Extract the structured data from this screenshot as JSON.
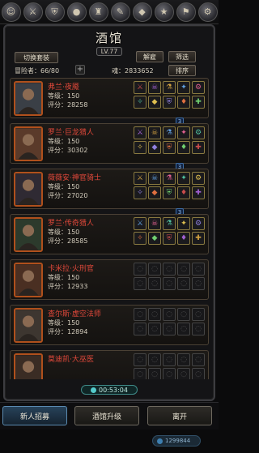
{
  "top_icons": [
    "person-icon",
    "sword-icon",
    "shield-icon",
    "orb-icon",
    "helmet-icon",
    "scroll-icon",
    "gem-icon",
    "star-icon",
    "flag-icon",
    "settings-icon"
  ],
  "header": {
    "title": "酒馆",
    "level": "LV.77"
  },
  "toolbar": {
    "switch_outfit": "切换套装",
    "dismiss": "解雇",
    "filter": "筛选",
    "sort": "排序"
  },
  "stats": {
    "adventurers_label": "冒险者：",
    "adventurers_value": "66/80",
    "soul_label": "魂：",
    "soul_value": "2833652"
  },
  "heroes": [
    {
      "name": "弗兰·夜魇",
      "level_label": "等级：",
      "level": "150",
      "score_label": "评分：",
      "score": "28258",
      "gear_filled": true,
      "linked": true
    },
    {
      "name": "罗兰·巨龙猎人",
      "level_label": "等级：",
      "level": "150",
      "score_label": "评分：",
      "score": "30302",
      "gear_filled": true,
      "linked": true
    },
    {
      "name": "薇薇安·神官骑士",
      "level_label": "等级：",
      "level": "150",
      "score_label": "评分：",
      "score": "27020",
      "gear_filled": true,
      "linked": true
    },
    {
      "name": "罗兰·传奇猎人",
      "level_label": "等级：",
      "level": "150",
      "score_label": "评分：",
      "score": "28585",
      "gear_filled": true,
      "linked": false
    },
    {
      "name": "卡米拉·火刑官",
      "level_label": "等级：",
      "level": "150",
      "score_label": "评分：",
      "score": "12933",
      "gear_filled": false,
      "linked": false
    },
    {
      "name": "查尔斯·虚空法师",
      "level_label": "等级：",
      "level": "150",
      "score_label": "评分：",
      "score": "12894",
      "gear_filled": false,
      "linked": false
    },
    {
      "name": "莫迪凯·大巫医",
      "level_label": "",
      "level": "",
      "score_label": "",
      "score": "",
      "gear_filled": false,
      "linked": false
    }
  ],
  "timer": "00:53:04",
  "bottom": {
    "recruit": "新人招募",
    "upgrade": "酒馆升级",
    "leave": "离开"
  },
  "footer_pill": "1299844"
}
